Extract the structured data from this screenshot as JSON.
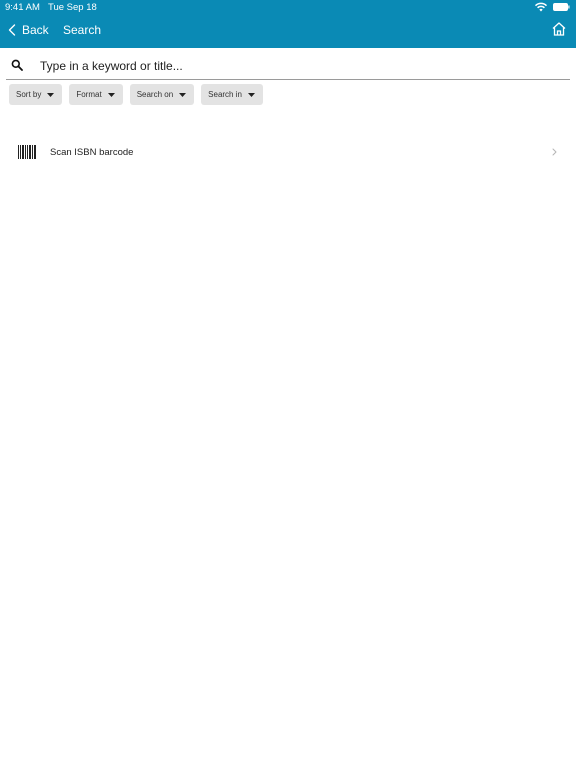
{
  "status_bar": {
    "time": "9:41 AM",
    "date": "Tue Sep 18"
  },
  "nav": {
    "back_label": "Back",
    "title": "Search"
  },
  "search": {
    "placeholder": "Type in a keyword or title..."
  },
  "filters": [
    {
      "label": "Sort by"
    },
    {
      "label": "Format"
    },
    {
      "label": "Search on"
    },
    {
      "label": "Search in"
    }
  ],
  "scan": {
    "label": "Scan ISBN barcode"
  },
  "icons": {
    "wifi": "wifi-icon",
    "battery": "battery-icon",
    "back": "chevron-left-icon",
    "home": "home-icon",
    "search": "search-icon",
    "caret": "caret-down-icon",
    "barcode": "barcode-icon",
    "disclosure": "chevron-right-icon"
  },
  "colors": {
    "header": "#0a8ab5",
    "chip": "#e3e3e3",
    "text": "#222222"
  }
}
